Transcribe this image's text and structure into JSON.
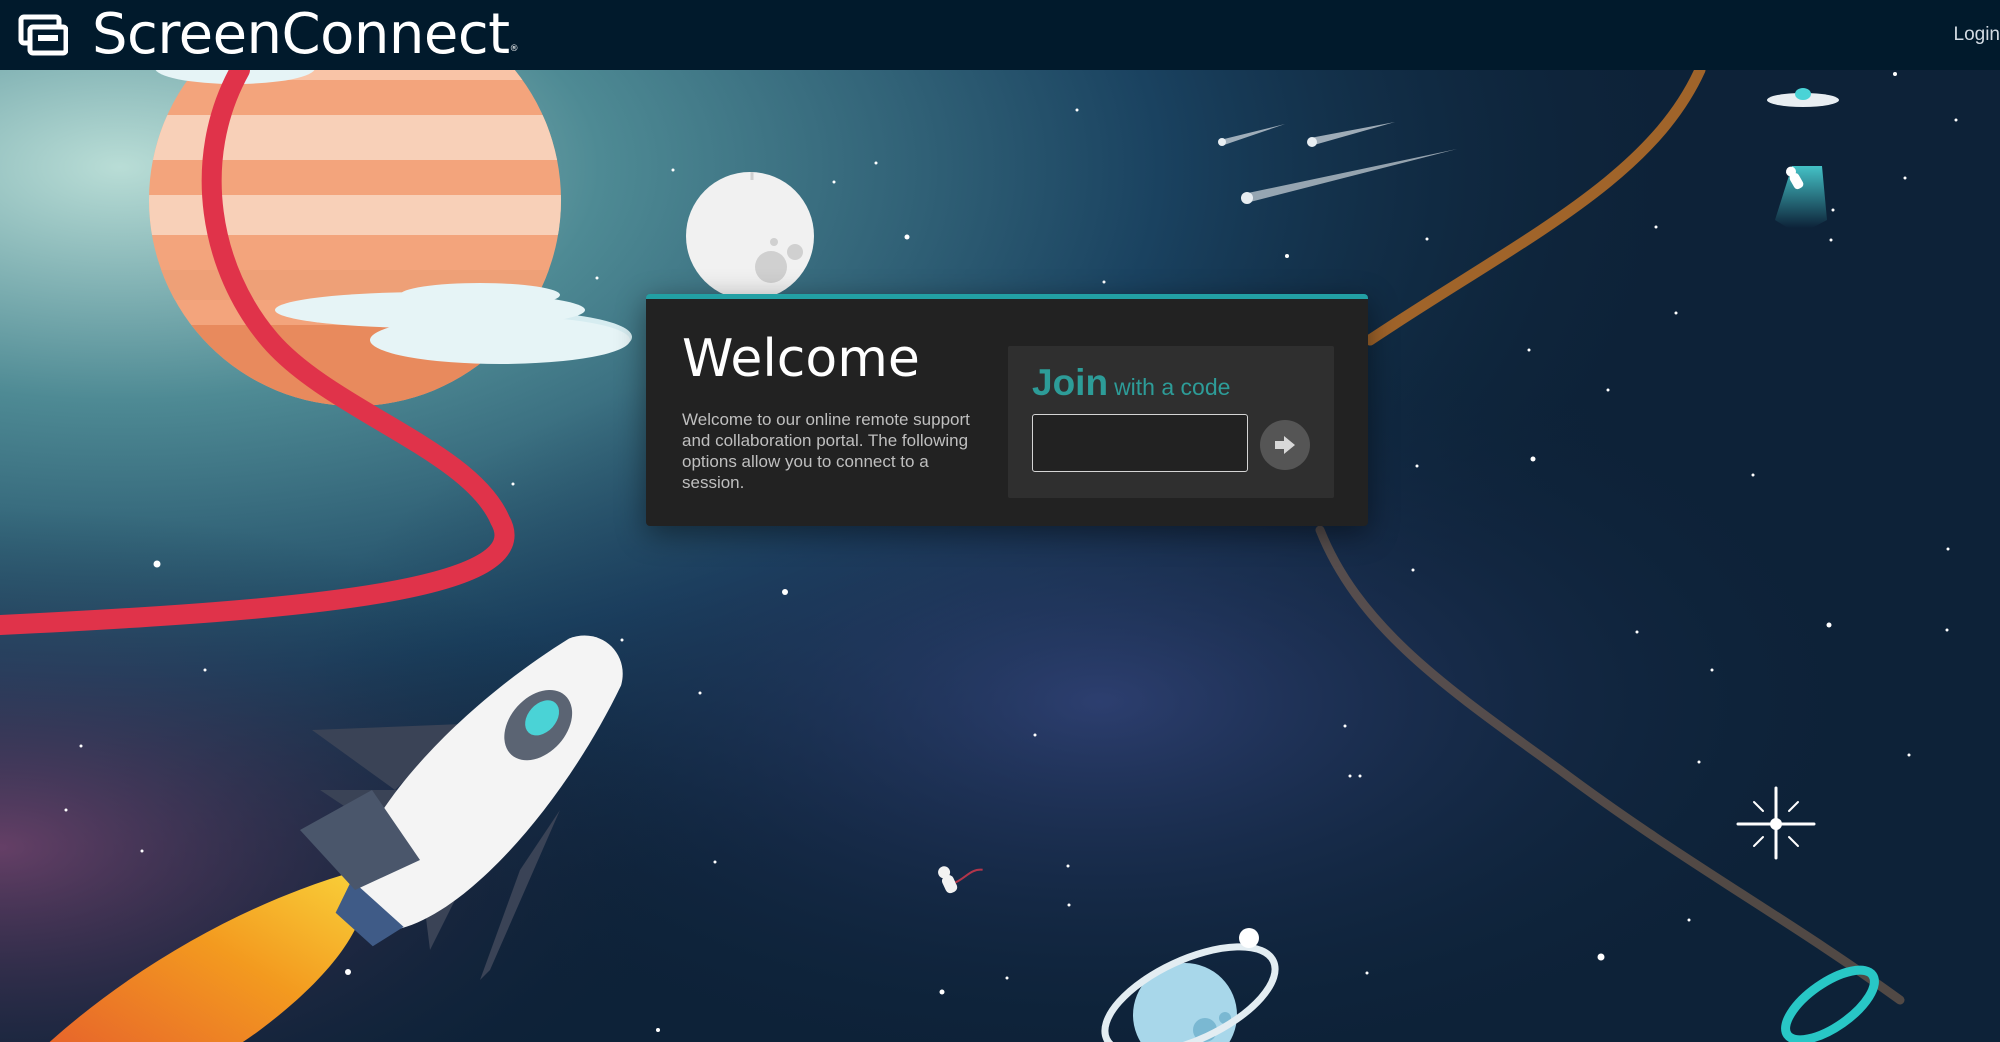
{
  "header": {
    "brand": "ScreenConnect",
    "brand_mark": "®",
    "logo_icon": "screenconnect-logo-icon",
    "login_label": "Login"
  },
  "welcome": {
    "title": "Welcome",
    "text": "Welcome to our online remote support and collaboration portal. The following options allow you to connect to a session."
  },
  "join": {
    "title": "Join",
    "subtitle": "with a code",
    "code_value": "",
    "submit_icon": "arrow-right-icon"
  },
  "colors": {
    "header_bg": "#011a2c",
    "card_bg": "#222222",
    "card_accent": "#22a0a4",
    "join_accent": "#2d9c98",
    "join_box_bg": "#2f2f2f"
  }
}
